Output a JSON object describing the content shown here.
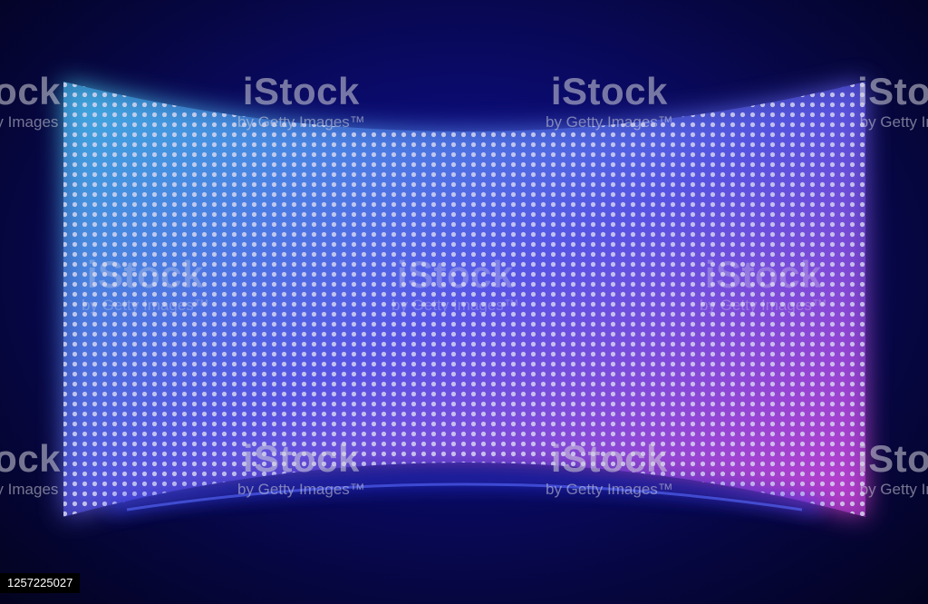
{
  "image": {
    "subject": "led-video-wall",
    "background_color": "#08086a",
    "gradient": {
      "top_left": "#4fe6ff",
      "middle": "#6f6cff",
      "bottom_right": "#ff4be6"
    },
    "led_columns": 80,
    "led_rows": 42
  },
  "watermark": {
    "brand": "iStock",
    "credit": "by Getty Images",
    "credit_tm": "by Getty Images™"
  },
  "stock_id": "1257225027"
}
